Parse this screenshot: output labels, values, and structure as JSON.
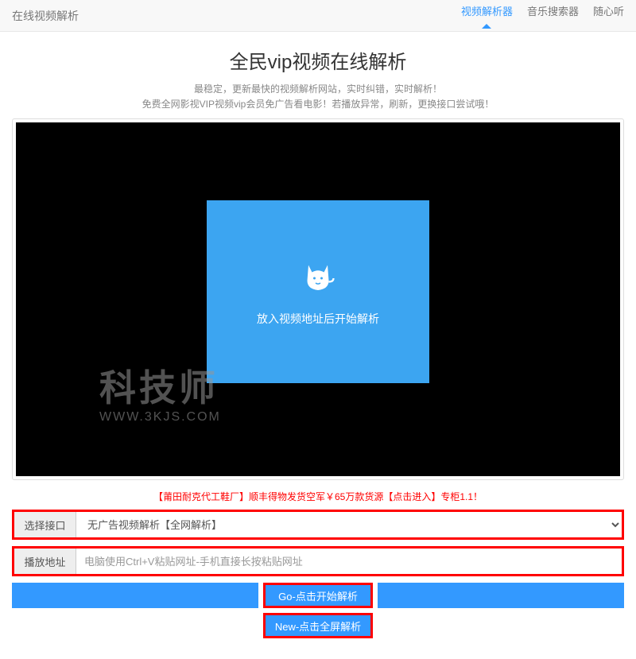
{
  "topbar": {
    "brand": "在线视频解析",
    "nav": [
      {
        "label": "视频解析器",
        "active": true
      },
      {
        "label": "音乐搜索器",
        "active": false
      },
      {
        "label": "随心听",
        "active": false
      }
    ]
  },
  "title": "全民vip视频在线解析",
  "subtitle_line1": "最稳定，更新最快的视频解析网站，实时纠错，实时解析！",
  "subtitle_line2": "免费全网影视VIP视频vip会员免广告看电影！若播放异常，刷新，更换接口尝试哦！",
  "player": {
    "prompt": "放入视频地址后开始解析"
  },
  "watermark": {
    "big": "科技师",
    "small": "WWW.3KJS.COM"
  },
  "promo": "【莆田耐克代工鞋厂】顺丰得物发货空军￥65万款货源【点击进入】专柜1.1！",
  "form": {
    "interface_label": "选择接口",
    "interface_selected": "无广告视频解析【全网解析】",
    "address_label": "播放地址",
    "address_placeholder": "电脑使用Ctrl+V粘贴网址-手机直接长按粘贴网址"
  },
  "buttons": {
    "go": "Go-点击开始解析",
    "new": "New-点击全屏解析"
  }
}
